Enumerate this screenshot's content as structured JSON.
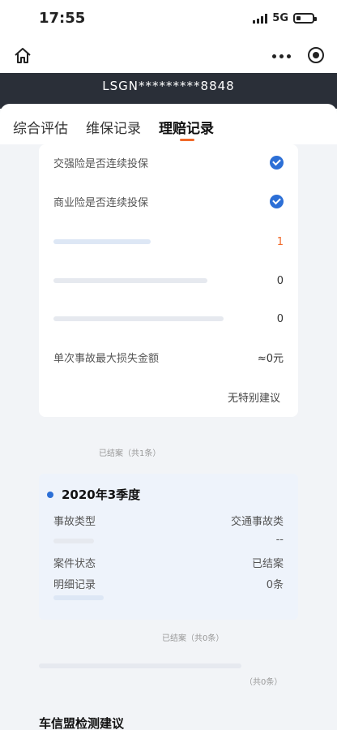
{
  "status_bar": {
    "time": "17:55",
    "network": "5G"
  },
  "vin": {
    "text": "LSGN*********8848"
  },
  "tabs": [
    {
      "label": "综合评估"
    },
    {
      "label": "维保记录"
    },
    {
      "label": "理赔记录"
    }
  ],
  "insurance": {
    "compulsory_label": "交强险是否连续投保",
    "commercial_label": "商业险是否连续投保",
    "claim_count_value": "1",
    "value_zero_a": "0",
    "value_zero_b": "0",
    "max_loss_label": "单次事故最大损失金额",
    "max_loss_value": "≈0元",
    "advice": "无特别建议"
  },
  "closed_summary_1": "已结案（共1条）",
  "record": {
    "title": "2020年3季度",
    "rows": [
      {
        "label": "事故类型",
        "value": "交通事故类"
      },
      {
        "label": "",
        "value": "--"
      },
      {
        "label": "案件状态",
        "value": "已结案"
      },
      {
        "label": "明细记录",
        "value": "0条"
      }
    ]
  },
  "closed_summary_2": "已结案（共0条）",
  "total_summary": "（共0条）",
  "section_title": "车信盟检测建议"
}
